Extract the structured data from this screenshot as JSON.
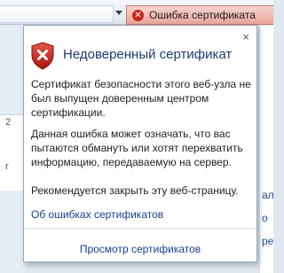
{
  "toolbar": {
    "cert_error_label": "Ошибка сертификата",
    "cert_error_icon": "error-x-icon"
  },
  "underlay": {
    "left_fragments": [
      "2",
      "r"
    ],
    "right_fragments": [
      "ал",
      "о",
      "ре"
    ]
  },
  "popup": {
    "title": "Недоверенный сертификат",
    "paragraph1": "Сертификат безопасности этого веб-узла не был выпущен доверенным центром сертификации.",
    "paragraph2": "Данная ошибка может означать, что вас пытаются обмануть или хотят перехватить информацию, передаваемую на сервер.",
    "paragraph3": "Рекомендуется закрыть эту веб-страницу.",
    "link_about": "Об ошибках сертификатов",
    "link_view": "Просмотр сертификатов",
    "close_label": "×"
  },
  "colors": {
    "error_red": "#c6261d",
    "link_blue": "#1a3f8f",
    "title_blue": "#1f3a6e"
  }
}
